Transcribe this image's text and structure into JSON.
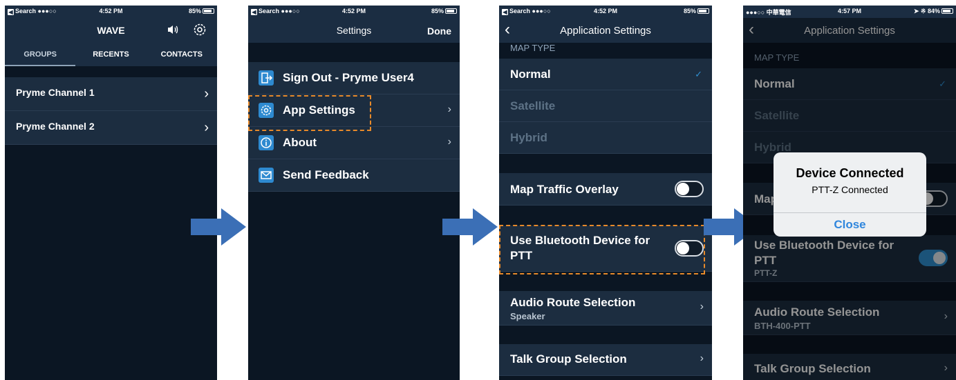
{
  "screen1": {
    "status": {
      "left": "Search ●●●○○",
      "time": "4:52 PM",
      "battery": "85%"
    },
    "title": "WAVE",
    "tabs": [
      "GROUPS",
      "RECENTS",
      "CONTACTS"
    ],
    "channels": [
      "Pryme Channel 1",
      "Pryme Channel 2"
    ]
  },
  "screen2": {
    "status": {
      "left": "Search ●●●○○",
      "time": "4:52 PM",
      "battery": "85%"
    },
    "title": "Settings",
    "done": "Done",
    "items": [
      "Sign Out - Pryme User4",
      "App Settings",
      "About",
      "Send Feedback"
    ]
  },
  "screen3": {
    "status": {
      "left": "Search ●●●○○",
      "time": "4:52 PM",
      "battery": "85%"
    },
    "title": "Application Settings",
    "map_type_header": "MAP TYPE",
    "map_types": [
      "Normal",
      "Satellite",
      "Hybrid"
    ],
    "traffic": "Map Traffic Overlay",
    "bluetooth": {
      "line1": "Use Bluetooth Device for",
      "line2": "PTT"
    },
    "audio": {
      "label": "Audio Route Selection",
      "value": "Speaker"
    },
    "talkgroup": "Talk Group Selection"
  },
  "screen4": {
    "status": {
      "left": "●●●○○ 中華電信",
      "time": "4:57 PM",
      "battery": "84%"
    },
    "title": "Application Settings",
    "map_type_header": "MAP TYPE",
    "map_types": [
      "Normal",
      "Satellite",
      "Hybrid"
    ],
    "traffic_partial": "Map",
    "bluetooth": {
      "line1": "Use Bluetooth Device for",
      "line2": "PTT",
      "value": "PTT-Z"
    },
    "audio": {
      "label": "Audio Route Selection",
      "value": "BTH-400-PTT"
    },
    "talkgroup": "Talk Group Selection",
    "alert": {
      "title": "Device Connected",
      "message": "PTT-Z Connected",
      "button": "Close"
    }
  },
  "colors": {
    "background": "#0b1623",
    "bar": "#1b2d42",
    "row": "#1c2d40",
    "accent": "#2f8fd0",
    "highlight_dash": "#e88a2a",
    "arrow": "#3b6fb6"
  },
  "icons": {
    "screen1_nav": [
      "volume-icon",
      "gear-icon"
    ],
    "screen2_items": [
      "sign-out-icon",
      "gear-icon",
      "info-icon",
      "mail-icon"
    ],
    "rows": "chevron-right-icon",
    "selected": "checkmark-icon",
    "flow": "arrow-right-icon"
  }
}
